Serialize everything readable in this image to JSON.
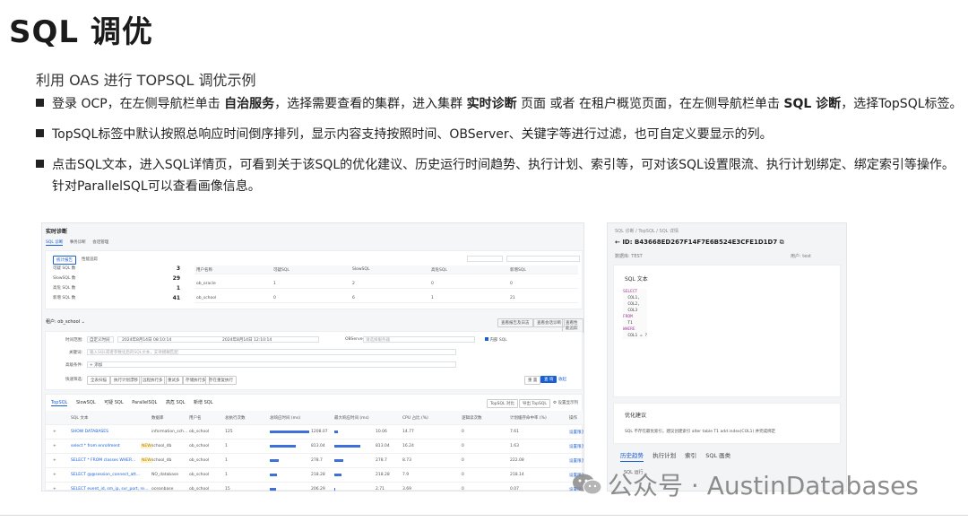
{
  "title": "SQL 调优",
  "subtitle": "利用 OAS 进行 TOPSQL 调优示例",
  "bullets": {
    "b1": {
      "p1": "登录 OCP，在左侧导航栏单击 ",
      "s1": "自治服务",
      "p2": "，选择需要查看的集群，进入集群 ",
      "s2": "实时诊断",
      "p3": " 页面 或者 在租户概览页面，在左侧导航栏单击 ",
      "s3": "SQL 诊断",
      "p4": "，选择TopSQL标签。"
    },
    "b2": "TopSQL标签中默认按照总响应时间倒序排列，显示内容支持按照时间、OBServer、关键字等进行过滤，也可自定义要显示的列。",
    "b3": "点击SQL文本，进入SQL详情页，可看到关于该SQL的优化建议、历史运行时间趋势、执行计划、索引等，可对该SQL设置限流、执行计划绑定、绑定索引等操作。",
    "b3_cont": "针对ParallelSQL可以查看画像信息。"
  },
  "left_shot": {
    "header": "实时诊断",
    "tabs": [
      "SQL 诊断",
      "事务诊断",
      "会话管理"
    ],
    "buttons": {
      "stats": "统计报告",
      "trace": "性能追踪",
      "scope": "查看报告及日志",
      "more1": "查看会话诊断",
      "more2": "查看性能追踪",
      "reset": "重 置",
      "query": "查 询",
      "collapse": "收起"
    },
    "summary": [
      {
        "label": "可疑 SQL 数",
        "value": "3"
      },
      {
        "label": "SlowSQL 数",
        "value": "29"
      },
      {
        "label": "高危 SQL 数",
        "value": "1"
      },
      {
        "label": "新增 SQL 数",
        "value": "41"
      }
    ],
    "mini_headers": [
      "用户名称",
      "可疑SQL",
      "SlowSQL",
      "高危SQL",
      "新增SQL"
    ],
    "mini_rows": [
      [
        "ob_oracle",
        "1",
        "2",
        "0",
        "0"
      ],
      [
        "ob_school",
        "0",
        "6",
        "1",
        "21"
      ]
    ],
    "tenant_label": "租户",
    "tenant_value": "ob_school",
    "filters": {
      "time_label": "时间范围:",
      "time_mode": "自定义时间",
      "time_start": "2024年8月14日 08:10:14",
      "time_end": "2024年8月14日 12:10:14",
      "server_label": "OBServer:",
      "server_placeholder": "请选择服务器",
      "internal_label": "内部 SQL",
      "keyword_label": "关键词:",
      "keyword_placeholder": "输入SQL或者参数化后的SQL文本，支持模糊匹配",
      "advanced_label": "高级条件:",
      "advanced_value": "+ 添加",
      "quick_label": "快速筛选:",
      "quick_items": [
        "全表扫描",
        "执行计划漂移",
        "远程执行多",
        "重试多",
        "存储执行多",
        "存在重复执行"
      ]
    },
    "sql_tabs": [
      "TopSQL",
      "SlowSQL",
      "可疑 SQL",
      "ParallelSQL",
      "高危 SQL",
      "新增 SQL"
    ],
    "sql_tab_actions": [
      "TopSQL 对比",
      "导出 TopSQL",
      "设置显示列"
    ],
    "table_headers": [
      "SQL 文本",
      "数据库",
      "用户名",
      "总执行次数",
      "总响应时间 (ms)",
      "最大响应时间 (ms)",
      "CPU 占比 (%)",
      "逻辑读次数",
      "计划缓存命中率 (%)",
      "操作"
    ],
    "rows": [
      {
        "sql": "SHOW DATABASES",
        "tag": "",
        "db": "information_sch...",
        "user": "ob_school",
        "exec": "125",
        "total": "1208.07",
        "max": "10.06",
        "cpu": "14.77",
        "lread": "0",
        "hit": "7.61",
        "op": "设置限流",
        "bar_total": 1.0,
        "bar_max": 0.08
      },
      {
        "sql": "select * from enrollment",
        "tag": "NEW",
        "db": "school_db",
        "user": "ob_school",
        "exec": "1",
        "total": "813.04",
        "max": "813.04",
        "cpu": "16.24",
        "lread": "0",
        "hit": "1.63",
        "op": "设置限流",
        "bar_total": 0.67,
        "bar_max": 0.67
      },
      {
        "sql": "SELECT * FROM classes WHER...",
        "tag": "NEW",
        "db": "school_db",
        "user": "ob_school",
        "exec": "1",
        "total": "278.7",
        "max": "278.7",
        "cpu": "8.73",
        "lread": "0",
        "hit": "222.08",
        "op": "设置限流",
        "bar_total": 0.23,
        "bar_max": 0.23
      },
      {
        "sql": "SELECT @@session_connect_att...",
        "tag": "",
        "db": "NO_database",
        "user": "ob_school",
        "exec": "1",
        "total": "218.28",
        "max": "218.28",
        "cpu": "7.9",
        "lread": "0",
        "hit": "218.14",
        "op": "设置限流",
        "bar_total": 0.18,
        "bar_max": 0.18
      },
      {
        "sql": "SELECT event_id, sm_ip, svr_port, re...",
        "tag": "",
        "db": "oceanbase",
        "user": "ob_school",
        "exec": "15",
        "total": "206.29",
        "max": "2.71",
        "cpu": "3.69",
        "lread": "0",
        "hit": "0.07",
        "op": "设置限流",
        "bar_total": 0.17,
        "bar_max": 0.02
      }
    ]
  },
  "right_shot": {
    "breadcrumb": "SQL 诊断  /  TopSQL  /  SQL 详情",
    "sql_id": "ID: B43668ED267F14F7E6B524E3CFE1D1D7",
    "db_label": "数据库:",
    "db_value": "TEST",
    "user_label": "用户:",
    "user_value": "test",
    "text_title": "SQL 文本",
    "code_lines": [
      {
        "kw": "SELECT",
        "rest": ""
      },
      {
        "kw": "",
        "rest": "  COL1,"
      },
      {
        "kw": "",
        "rest": "  COL2,"
      },
      {
        "kw": "",
        "rest": "  COL3"
      },
      {
        "kw": "FROM",
        "rest": ""
      },
      {
        "kw": "",
        "rest": "  T1"
      },
      {
        "kw": "WHERE",
        "rest": ""
      },
      {
        "kw": "",
        "rest": "  COL1 = ?"
      }
    ],
    "advice_title": "优化建议",
    "advice_text": "SQL 不存在最优索引，建议创建索引 alter table T1 add index(COL1) 并完成绑定",
    "tabs": [
      "历史趋势",
      "执行计划",
      "索引",
      "SQL 画类"
    ],
    "run_label": "SQL 运行"
  },
  "watermark": "公众号 · AustinDatabases"
}
